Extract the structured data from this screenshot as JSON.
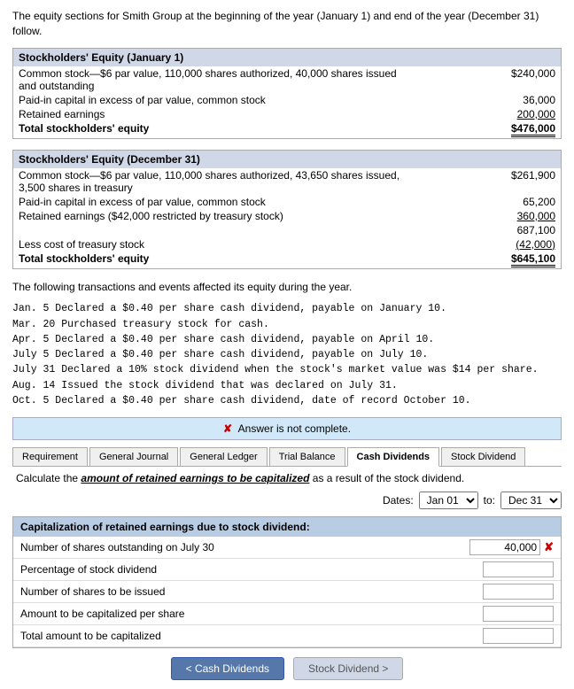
{
  "intro": {
    "text": "The equity sections for Smith Group at the beginning of the year (January 1) and end of the year (December 31) follow."
  },
  "equity_jan": {
    "header": "Stockholders' Equity (January 1)",
    "rows": [
      {
        "label": "Common stock—$6 par value, 110,000 shares authorized, 40,000 shares issued and outstanding",
        "value": "$240,000",
        "indent": false,
        "bold": false,
        "underline": false
      },
      {
        "label": "Paid-in capital in excess of par value, common stock",
        "value": "36,000",
        "indent": false,
        "bold": false,
        "underline": false
      },
      {
        "label": "Retained earnings",
        "value": "200,000",
        "indent": false,
        "bold": false,
        "underline": true
      },
      {
        "label": "Total stockholders' equity",
        "value": "$476,000",
        "indent": false,
        "bold": false,
        "underline": "double"
      }
    ]
  },
  "equity_dec": {
    "header": "Stockholders' Equity (December 31)",
    "rows": [
      {
        "label": "Common stock—$6 par value, 110,000 shares authorized, 43,650 shares issued, 3,500 shares in treasury",
        "value": "$261,900",
        "indent": false,
        "bold": false,
        "underline": false
      },
      {
        "label": "Paid-in capital in excess of par value, common stock",
        "value": "65,200",
        "indent": false,
        "bold": false,
        "underline": false
      },
      {
        "label": "Retained earnings ($42,000 restricted by treasury stock)",
        "value": "360,000",
        "indent": false,
        "bold": false,
        "underline": true
      },
      {
        "label": "",
        "value": "687,100",
        "indent": false,
        "bold": false,
        "underline": false
      },
      {
        "label": "Less cost of treasury stock",
        "value": "(42,000)",
        "indent": false,
        "bold": false,
        "underline": true
      },
      {
        "label": "Total stockholders' equity",
        "value": "$645,100",
        "indent": false,
        "bold": false,
        "underline": "double"
      }
    ]
  },
  "transactions_intro": "The following transactions and events affected its equity during the year.",
  "transactions": [
    "Jan.  5 Declared a $0.40 per share cash dividend, payable on January 10.",
    "Mar. 20 Purchased treasury stock for cash.",
    "Apr.  5 Declared a $0.40 per share cash dividend, payable on April 10.",
    "July  5 Declared a $0.40 per share cash dividend, payable on July 10.",
    "July 31 Declared a 10% stock dividend when the stock's market value was $14 per share.",
    "Aug. 14 Issued the stock dividend that was declared on July 31.",
    "Oct.  5 Declared a $0.40 per share cash dividend, date of record October 10."
  ],
  "answer_incomplete": "Answer is not complete.",
  "tabs": [
    {
      "label": "Requirement",
      "active": false
    },
    {
      "label": "General Journal",
      "active": false
    },
    {
      "label": "General Ledger",
      "active": false
    },
    {
      "label": "Trial Balance",
      "active": false
    },
    {
      "label": "Cash Dividends",
      "active": true
    },
    {
      "label": "Stock Dividend",
      "active": false
    }
  ],
  "calc_instruction": "Calculate the amount of retained earnings to be capitalized as a result of the stock dividend.",
  "dates_label": "Dates:",
  "date_from": "Jan 01",
  "date_to_label": "to:",
  "date_to": "Dec 31",
  "cap_table": {
    "header": "Capitalization of retained earnings due to stock dividend:",
    "rows": [
      {
        "label": "Number of shares outstanding on July 30",
        "value": "40,000",
        "has_error": true
      },
      {
        "label": "Percentage of stock dividend",
        "value": "",
        "has_error": false
      },
      {
        "label": "Number of shares to be issued",
        "value": "",
        "has_error": false
      },
      {
        "label": "Amount to be capitalized per share",
        "value": "",
        "has_error": false
      },
      {
        "label": "Total amount to be capitalized",
        "value": "",
        "has_error": false
      }
    ]
  },
  "nav": {
    "prev_label": "< Cash Dividends",
    "next_label": "Stock Dividend >",
    "prev_active": true,
    "next_active": false
  }
}
